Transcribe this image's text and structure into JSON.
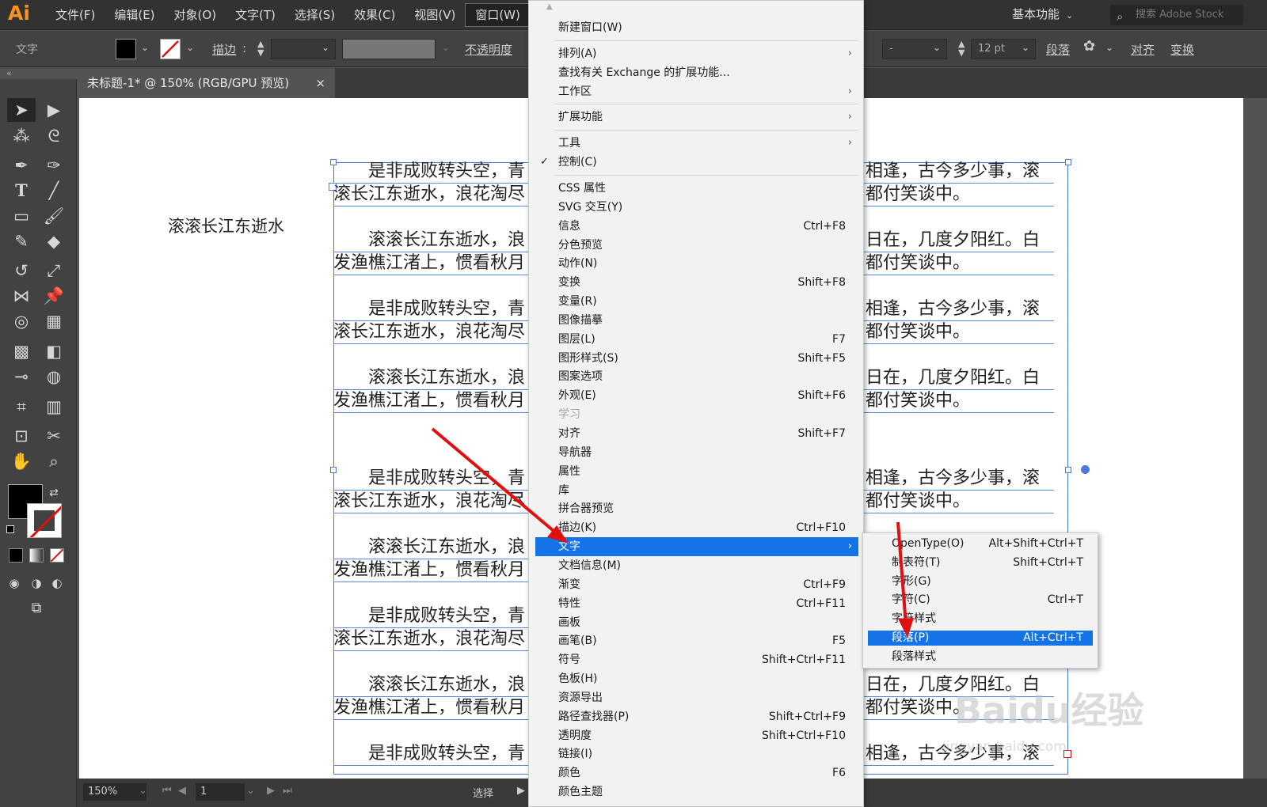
{
  "app": {
    "logo": "Ai"
  },
  "menubar": {
    "items": [
      "文件(F)",
      "编辑(E)",
      "对象(O)",
      "文字(T)",
      "选择(S)",
      "效果(C)",
      "视图(V)",
      "窗口(W)"
    ],
    "active_index": 7,
    "workspace": "基本功能",
    "stock_placeholder": "搜索 Adobe Stock"
  },
  "controlbar": {
    "label": "文字",
    "stroke_label": "描边",
    "opacity_label": "不透明度",
    "font_size": "12 pt",
    "font_field": "-",
    "paragraph_label": "段落",
    "align_label": "对齐",
    "transform_label": "变换"
  },
  "document": {
    "tab_title": "未标题-1* @ 150% (RGB/GPU 预览)",
    "close": "×"
  },
  "canvas": {
    "point_text": "滚滚长江东逝水",
    "paragraphs": [
      {
        "l1_left": "　　是非成败转头空，青",
        "l1_right": "相逢，古今多少事，滚",
        "l2_left": "滚长江东逝水，浪花淘尽",
        "l2_right": "都付笑谈中。"
      },
      {
        "l1_left": "　　滚滚长江东逝水，浪",
        "l1_right": "日在，几度夕阳红。白",
        "l2_left": "发渔樵江渚上，惯看秋月",
        "l2_right": "都付笑谈中。"
      }
    ]
  },
  "statusbar": {
    "zoom": "150%",
    "page": "1",
    "label": "选择"
  },
  "window_menu": {
    "items": [
      {
        "label": "新建窗口(W)"
      },
      {
        "sep": true
      },
      {
        "label": "排列(A)",
        "submenu": true
      },
      {
        "label": "查找有关 Exchange 的扩展功能..."
      },
      {
        "label": "工作区",
        "submenu": true
      },
      {
        "sep": true
      },
      {
        "label": "扩展功能",
        "submenu": true
      },
      {
        "sep": true
      },
      {
        "label": "工具",
        "submenu": true
      },
      {
        "label": "控制(C)",
        "checked": true
      },
      {
        "sep": true
      },
      {
        "label": "CSS 属性"
      },
      {
        "label": "SVG 交互(Y)"
      },
      {
        "label": "信息",
        "shortcut": "Ctrl+F8"
      },
      {
        "label": "分色预览"
      },
      {
        "label": "动作(N)"
      },
      {
        "label": "变换",
        "shortcut": "Shift+F8"
      },
      {
        "label": "变量(R)"
      },
      {
        "label": "图像描摹"
      },
      {
        "label": "图层(L)",
        "shortcut": "F7"
      },
      {
        "label": "图形样式(S)",
        "shortcut": "Shift+F5"
      },
      {
        "label": "图案选项"
      },
      {
        "label": "外观(E)",
        "shortcut": "Shift+F6"
      },
      {
        "label": "学习",
        "disabled": true
      },
      {
        "label": "对齐",
        "shortcut": "Shift+F7"
      },
      {
        "label": "导航器"
      },
      {
        "label": "属性"
      },
      {
        "label": "库"
      },
      {
        "label": "拼合器预览"
      },
      {
        "label": "描边(K)",
        "shortcut": "Ctrl+F10"
      },
      {
        "label": "文字",
        "submenu": true,
        "highlighted": true
      },
      {
        "label": "文档信息(M)"
      },
      {
        "label": "渐变",
        "shortcut": "Ctrl+F9"
      },
      {
        "label": "特性",
        "shortcut": "Ctrl+F11"
      },
      {
        "label": "画板"
      },
      {
        "label": "画笔(B)",
        "shortcut": "F5"
      },
      {
        "label": "符号",
        "shortcut": "Shift+Ctrl+F11"
      },
      {
        "label": "色板(H)"
      },
      {
        "label": "资源导出"
      },
      {
        "label": "路径查找器(P)",
        "shortcut": "Shift+Ctrl+F9"
      },
      {
        "label": "透明度",
        "shortcut": "Shift+Ctrl+F10"
      },
      {
        "label": "链接(I)"
      },
      {
        "label": "颜色",
        "shortcut": "F6"
      },
      {
        "label": "颜色主题"
      }
    ]
  },
  "type_submenu": {
    "items": [
      {
        "label": "OpenType(O)",
        "shortcut": "Alt+Shift+Ctrl+T"
      },
      {
        "label": "制表符(T)",
        "shortcut": "Shift+Ctrl+T"
      },
      {
        "label": "字形(G)"
      },
      {
        "label": "字符(C)",
        "shortcut": "Ctrl+T"
      },
      {
        "label": "字符样式"
      },
      {
        "label": "段落(P)",
        "shortcut": "Alt+Ctrl+T",
        "highlighted": true
      },
      {
        "label": "段落样式"
      }
    ]
  },
  "colors": {
    "accent": "#1473e6",
    "annotation_arrow": "#e01010",
    "selection": "#4a7bd9",
    "logo": "#f7931e"
  },
  "watermark": {
    "brand": "Baidu经验",
    "url": "jingyan.baidu.com"
  }
}
